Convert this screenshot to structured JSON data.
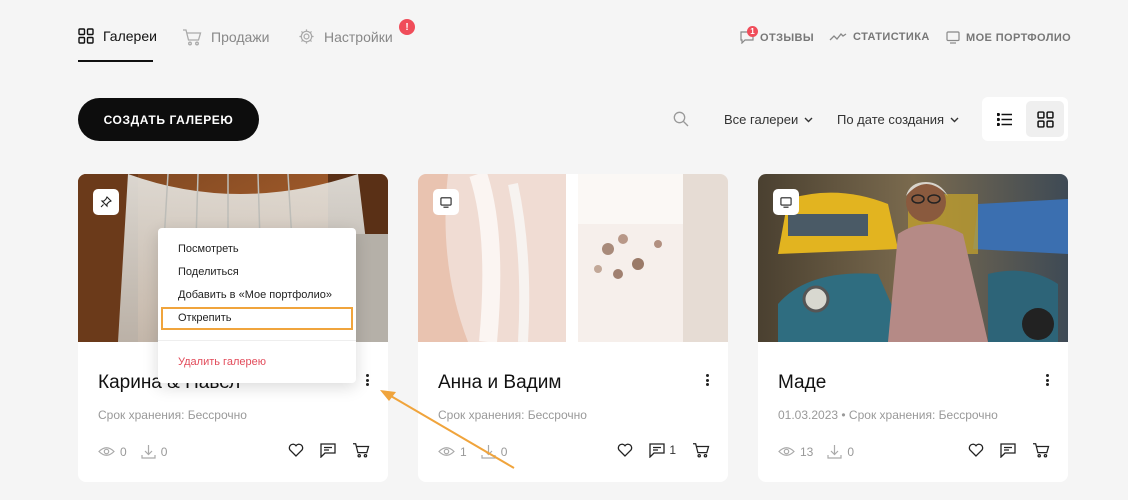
{
  "nav": {
    "galleries": "Галереи",
    "sales": "Продажи",
    "settings": "Настройки",
    "settings_badge": "!",
    "reviews": "ОТЗЫВЫ",
    "reviews_badge": "1",
    "stats": "СТАТИСТИКА",
    "portfolio": "МОЕ ПОРТФОЛИО"
  },
  "toolbar": {
    "create_label": "СОЗДАТЬ ГАЛЕРЕЮ",
    "filter_label": "Все галереи",
    "sort_label": "По дате создания"
  },
  "cards": [
    {
      "title": "Карина & Павел",
      "meta": "Срок хранения: Бессрочно",
      "views": "0",
      "downloads": "0",
      "comments": "",
      "corner_icon": "pin-icon"
    },
    {
      "title": "Анна и Вадим",
      "meta": "Срок хранения: Бессрочно",
      "views": "1",
      "downloads": "0",
      "comments": "1",
      "corner_icon": "monitor-icon"
    },
    {
      "title": "Маде",
      "meta": "01.03.2023  •  Срок хранения: Бессрочно",
      "views": "13",
      "downloads": "0",
      "comments": "",
      "corner_icon": "monitor-icon"
    }
  ],
  "context_menu": {
    "view": "Посмотреть",
    "share": "Поделиться",
    "add_portfolio": "Добавить в «Мое портфолио»",
    "unpin": "Открепить",
    "delete": "Удалить галерею"
  },
  "colors": {
    "accent": "#0d0d0d",
    "badge": "#f04d5a",
    "highlight": "#f0a43c",
    "danger": "#e24b5a"
  }
}
